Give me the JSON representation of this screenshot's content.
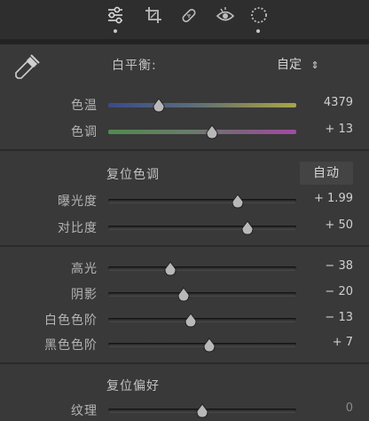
{
  "toolbar": {
    "tools": [
      {
        "icon": "sliders-icon",
        "active": true
      },
      {
        "icon": "crop-icon",
        "active": false
      },
      {
        "icon": "healing-bandage-icon",
        "active": false
      },
      {
        "icon": "red-eye-icon",
        "active": false
      },
      {
        "icon": "mask-circle-icon",
        "active": true
      }
    ]
  },
  "white_balance": {
    "label": "白平衡:",
    "preset": "自定",
    "preset_arrow": "÷",
    "eyedropper_icon": "eyedropper-icon"
  },
  "sliders_wb": [
    {
      "label": "色温",
      "value": "4379",
      "position": 0.27
    },
    {
      "label": "色调",
      "value": "+ 13",
      "position": 0.55
    }
  ],
  "tone": {
    "reset_label": "复位色调",
    "auto_label": "自动"
  },
  "sliders_tone": [
    {
      "label": "曝光度",
      "value": "+ 1.99",
      "position": 0.69
    },
    {
      "label": "对比度",
      "value": "+ 50",
      "position": 0.74
    }
  ],
  "sliders_tone2": [
    {
      "label": "高光",
      "value": "− 38",
      "position": 0.33
    },
    {
      "label": "阴影",
      "value": "− 20",
      "position": 0.4
    },
    {
      "label": "白色色阶",
      "value": "− 13",
      "position": 0.44
    },
    {
      "label": "黑色色阶",
      "value": "+ 7",
      "position": 0.54
    }
  ],
  "presence": {
    "reset_label": "复位偏好"
  },
  "sliders_presence": [
    {
      "label": "纹理",
      "value": "0",
      "position": 0.5
    }
  ],
  "colors": {
    "accent": "#c8c8c8",
    "panel_bg": "#393939",
    "toolbar_bg": "#2e2e2e"
  }
}
